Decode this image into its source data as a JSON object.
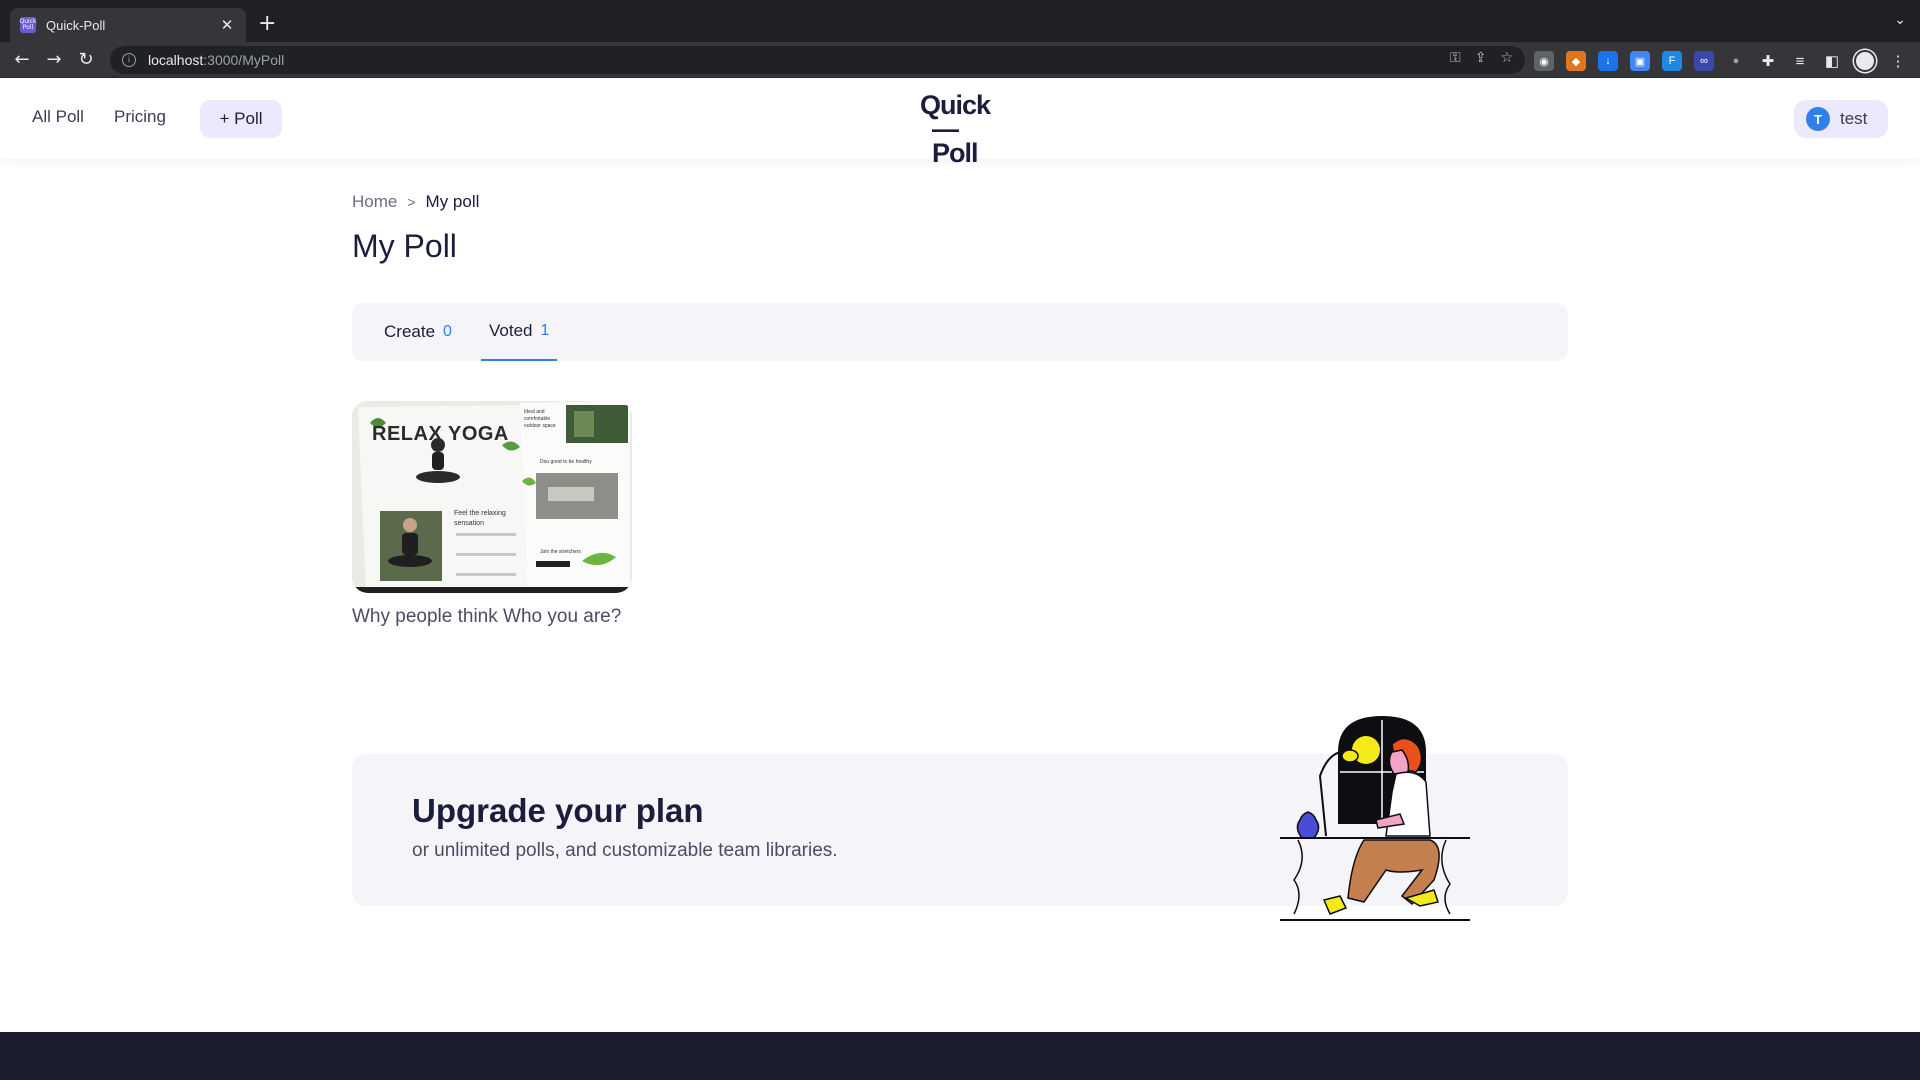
{
  "browser": {
    "tab_title": "Quick-Poll",
    "favicon_text": "Quick Poll",
    "url_host": "localhost",
    "url_path": ":3000/MyPoll",
    "colors": {
      "tabbar": "#1f2023",
      "toolbar": "#35363a"
    }
  },
  "header": {
    "nav_all_poll": "All Poll",
    "nav_pricing": "Pricing",
    "add_poll_label": "+ Poll",
    "logo_line1": "Quick",
    "logo_line2": "—Poll",
    "user_initial": "T",
    "user_name": "test"
  },
  "breadcrumb": {
    "home": "Home",
    "separator": ">",
    "current": "My poll"
  },
  "page_title": "My Poll",
  "tabs": [
    {
      "label": "Create",
      "count": "0",
      "active": false
    },
    {
      "label": "Voted",
      "count": "1",
      "active": true
    }
  ],
  "polls": [
    {
      "title": "Why people think Who you are?",
      "thumbnail": {
        "headline": "RELAX YOGA",
        "caption_1": "Feel the relaxing sensation",
        "caption_2": "Ideal and comfortable outdoor space",
        "caption_3": "Dou good to be healthy",
        "caption_4": "Join the stretchers"
      }
    }
  ],
  "upgrade": {
    "title": "Upgrade your plan",
    "subtitle": "or unlimited polls, and customizable team libraries."
  },
  "colors": {
    "accent_blue": "#2f80ed",
    "chip_bg": "#ece9fc",
    "panel_bg": "#f5f4f9",
    "brand_text": "#1b1d3d",
    "footer": "#1b1d2e"
  }
}
